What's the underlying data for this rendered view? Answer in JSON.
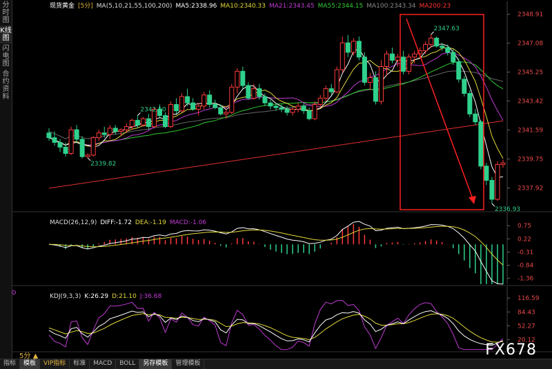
{
  "sidebar": {
    "tabs": [
      {
        "label": "分时图",
        "active": false
      },
      {
        "label": "K线图",
        "active": true
      },
      {
        "label": "闪电图",
        "active": false
      },
      {
        "label": "合约资料",
        "active": false
      }
    ]
  },
  "main_panel": {
    "title": "现货黄金",
    "period": "5分",
    "ma_text": "MA(5,10,21,55,100,200)",
    "ma_values": [
      {
        "label": "MA5:2338.96",
        "color": "#ffffff"
      },
      {
        "label": "MA10:2340.33",
        "color": "#e3d93b"
      },
      {
        "label": "MA21:2343.45",
        "color": "#c03ad3"
      },
      {
        "label": "MA55:2344.15",
        "color": "#33cc33"
      },
      {
        "label": "MA100:2343.34",
        "color": "#888888"
      },
      {
        "label": "MA200:23",
        "color": "#ff3333"
      }
    ]
  },
  "macd_panel": {
    "title": "MACD(26,12,9)",
    "values": [
      {
        "label": "DIFF:-1.72",
        "color": "#ffffff"
      },
      {
        "label": "DEA:-1.19",
        "color": "#e3d93b"
      },
      {
        "label": "MACD:-1.06",
        "color": "#c03ad3"
      }
    ]
  },
  "kdj_panel": {
    "title": "KDJ(9,3,3)",
    "values": [
      {
        "label": "K:26.29",
        "color": "#ffffff"
      },
      {
        "label": "D:21.10",
        "color": "#e3d93b"
      },
      {
        "label": "J:36.68",
        "color": "#c03ad3"
      }
    ]
  },
  "bottom_tabs": [
    {
      "label": "指标",
      "active": false,
      "vip": false
    },
    {
      "label": "模板",
      "active": true,
      "vip": false
    },
    {
      "label": "VIP指标",
      "active": false,
      "vip": true
    },
    {
      "label": "标准",
      "active": false,
      "vip": false
    },
    {
      "label": "MACD",
      "active": false,
      "vip": false
    },
    {
      "label": "BOLL",
      "active": false,
      "vip": false
    },
    {
      "label": "另存模板",
      "active": true,
      "vip": false
    },
    {
      "label": "管理模板",
      "active": false,
      "vip": false
    }
  ],
  "timeframe_label": "5分",
  "watermark": "FX678",
  "colors": {
    "up": "#ff3b3b",
    "down": "#2fd18c",
    "grid": "#2a2a2a",
    "axis_text": "#e84848",
    "annot": "#2fd18c",
    "box": "#ff2020"
  },
  "chart_data": [
    {
      "type": "candlestick",
      "name": "price",
      "ylim": [
        2336.5,
        2349.2
      ],
      "y_ticks": [
        2348.91,
        2347.08,
        2345.25,
        2343.42,
        2341.59,
        2339.75,
        2337.92
      ],
      "candles": [
        [
          2341.4,
          2341.7,
          2340.9,
          2341.1
        ],
        [
          2341.1,
          2341.5,
          2340.6,
          2340.8
        ],
        [
          2340.8,
          2341.0,
          2340.2,
          2340.5
        ],
        [
          2340.5,
          2340.8,
          2339.9,
          2340.1
        ],
        [
          2340.1,
          2341.8,
          2340.0,
          2341.6
        ],
        [
          2341.6,
          2341.9,
          2340.8,
          2341.0
        ],
        [
          2341.0,
          2341.2,
          2339.8,
          2339.9
        ],
        [
          2339.9,
          2340.1,
          2339.82,
          2340.0
        ],
        [
          2340.0,
          2341.2,
          2339.9,
          2341.1
        ],
        [
          2341.1,
          2341.6,
          2340.9,
          2341.4
        ],
        [
          2341.4,
          2341.8,
          2341.1,
          2341.3
        ],
        [
          2341.3,
          2341.9,
          2341.0,
          2341.7
        ],
        [
          2341.7,
          2341.9,
          2341.3,
          2341.5
        ],
        [
          2341.5,
          2341.7,
          2341.2,
          2341.6
        ],
        [
          2341.6,
          2342.0,
          2341.4,
          2341.8
        ],
        [
          2341.8,
          2342.3,
          2341.6,
          2342.2
        ],
        [
          2342.2,
          2342.5,
          2341.7,
          2341.9
        ],
        [
          2341.9,
          2342.4,
          2341.8,
          2342.3
        ],
        [
          2342.3,
          2342.6,
          2341.6,
          2341.8
        ],
        [
          2341.8,
          2343.0,
          2341.7,
          2342.9
        ],
        [
          2342.9,
          2343.2,
          2342.3,
          2342.5
        ],
        [
          2342.5,
          2342.7,
          2341.7,
          2341.8
        ],
        [
          2341.8,
          2343.4,
          2341.7,
          2343.2
        ],
        [
          2343.2,
          2343.6,
          2342.6,
          2342.8
        ],
        [
          2342.8,
          2343.9,
          2342.7,
          2343.7
        ],
        [
          2343.7,
          2344.2,
          2343.1,
          2343.3
        ],
        [
          2343.3,
          2343.6,
          2342.8,
          2342.9
        ],
        [
          2342.9,
          2343.3,
          2342.5,
          2343.1
        ],
        [
          2343.1,
          2344.0,
          2342.9,
          2343.8
        ],
        [
          2343.8,
          2344.1,
          2343.0,
          2343.2
        ],
        [
          2343.2,
          2343.5,
          2342.9,
          2343.0
        ],
        [
          2343.0,
          2343.2,
          2342.5,
          2342.6
        ],
        [
          2342.6,
          2342.9,
          2342.3,
          2342.7
        ],
        [
          2342.7,
          2344.5,
          2342.6,
          2344.3
        ],
        [
          2344.3,
          2345.5,
          2343.9,
          2345.3
        ],
        [
          2345.3,
          2345.6,
          2344.2,
          2344.4
        ],
        [
          2344.4,
          2344.6,
          2343.5,
          2343.6
        ],
        [
          2343.6,
          2344.5,
          2343.5,
          2344.2
        ],
        [
          2344.2,
          2344.5,
          2343.5,
          2343.7
        ],
        [
          2343.7,
          2343.9,
          2343.1,
          2343.3
        ],
        [
          2343.3,
          2343.5,
          2342.9,
          2343.1
        ],
        [
          2343.1,
          2343.3,
          2342.8,
          2343.0
        ],
        [
          2343.0,
          2343.2,
          2342.7,
          2342.9
        ],
        [
          2342.9,
          2343.1,
          2342.5,
          2342.7
        ],
        [
          2342.7,
          2343.0,
          2342.5,
          2342.9
        ],
        [
          2342.9,
          2343.3,
          2342.7,
          2343.1
        ],
        [
          2343.1,
          2343.3,
          2342.6,
          2342.8
        ],
        [
          2342.8,
          2343.0,
          2342.2,
          2342.3
        ],
        [
          2342.3,
          2343.4,
          2342.2,
          2343.2
        ],
        [
          2343.2,
          2343.8,
          2343.0,
          2343.6
        ],
        [
          2343.6,
          2344.4,
          2343.4,
          2344.2
        ],
        [
          2344.2,
          2344.5,
          2343.8,
          2344.0
        ],
        [
          2344.0,
          2345.6,
          2343.9,
          2345.4
        ],
        [
          2345.4,
          2347.5,
          2345.2,
          2347.1
        ],
        [
          2347.1,
          2347.6,
          2346.2,
          2346.5
        ],
        [
          2346.5,
          2347.4,
          2346.3,
          2347.2
        ],
        [
          2347.2,
          2347.5,
          2346.0,
          2346.2
        ],
        [
          2346.2,
          2346.5,
          2344.4,
          2344.6
        ],
        [
          2344.6,
          2345.2,
          2344.1,
          2344.9
        ],
        [
          2344.9,
          2345.3,
          2343.2,
          2343.4
        ],
        [
          2343.4,
          2346.0,
          2343.2,
          2345.6
        ],
        [
          2345.6,
          2346.6,
          2345.0,
          2346.4
        ],
        [
          2346.4,
          2346.8,
          2345.8,
          2346.0
        ],
        [
          2346.0,
          2346.4,
          2345.6,
          2346.2
        ],
        [
          2346.2,
          2346.6,
          2345.1,
          2345.3
        ],
        [
          2345.3,
          2346.4,
          2345.1,
          2346.2
        ],
        [
          2346.2,
          2346.6,
          2345.8,
          2346.4
        ],
        [
          2346.4,
          2346.8,
          2346.1,
          2346.6
        ],
        [
          2346.6,
          2347.2,
          2346.4,
          2347.0
        ],
        [
          2347.0,
          2347.63,
          2346.8,
          2347.4
        ],
        [
          2347.4,
          2347.5,
          2346.8,
          2346.9
        ],
        [
          2346.9,
          2347.1,
          2346.6,
          2346.8
        ],
        [
          2346.8,
          2347.0,
          2346.3,
          2346.5
        ],
        [
          2346.5,
          2346.7,
          2345.7,
          2345.9
        ],
        [
          2345.9,
          2346.1,
          2344.6,
          2344.8
        ],
        [
          2344.8,
          2345.0,
          2343.7,
          2343.9
        ],
        [
          2343.9,
          2344.1,
          2342.4,
          2342.6
        ],
        [
          2342.6,
          2342.9,
          2341.9,
          2342.1
        ],
        [
          2342.1,
          2342.2,
          2339.1,
          2339.3
        ],
        [
          2339.3,
          2339.5,
          2338.1,
          2338.4
        ],
        [
          2338.4,
          2338.6,
          2336.93,
          2337.2
        ],
        [
          2337.2,
          2339.6,
          2337.1,
          2339.4
        ],
        [
          2339.4,
          2339.7,
          2339.2,
          2339.5
        ]
      ],
      "annotations": [
        {
          "text": "2347.63",
          "value": 2347.63
        },
        {
          "text": "2339.82",
          "value": 2339.82
        },
        {
          "text": "2342.50",
          "value": 2342.5
        },
        {
          "text": "2336.93",
          "value": 2336.93
        }
      ]
    },
    {
      "type": "bar+line",
      "name": "MACD",
      "ylim": [
        -1.6,
        0.95
      ],
      "y_ticks": [
        0.75,
        0.22,
        -0.31,
        -0.84,
        -1.36
      ]
    },
    {
      "type": "line",
      "name": "KDJ",
      "ylim": [
        -5,
        125
      ],
      "y_ticks": [
        116.59,
        84.43,
        52.27,
        20.12
      ]
    }
  ]
}
